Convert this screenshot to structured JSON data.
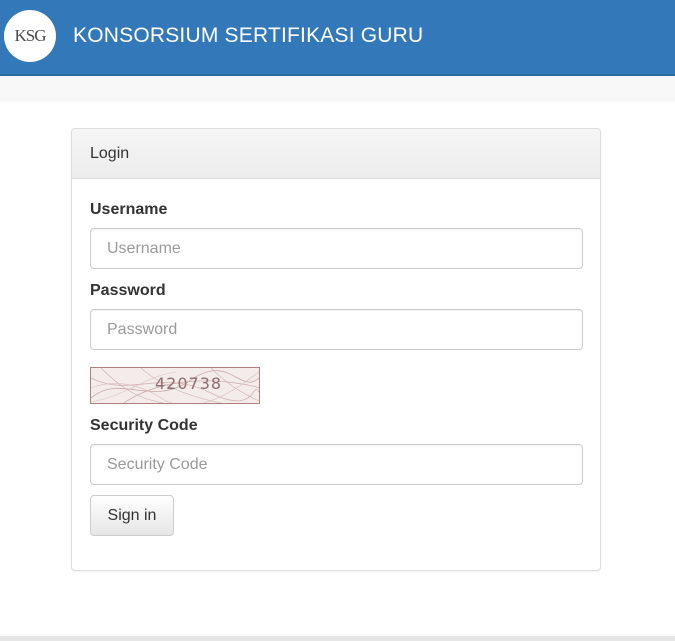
{
  "header": {
    "logo_text": "KSG",
    "title": "KONSORSIUM SERTIFIKASI GURU",
    "bar_color": "#3378b8"
  },
  "login": {
    "panel_title": "Login",
    "username_label": "Username",
    "username_placeholder": "Username",
    "username_value": "",
    "password_label": "Password",
    "password_placeholder": "Password",
    "password_value": "",
    "captcha_code": "420738",
    "security_label": "Security Code",
    "security_placeholder": "Security Code",
    "security_value": "",
    "submit_label": "Sign in"
  }
}
